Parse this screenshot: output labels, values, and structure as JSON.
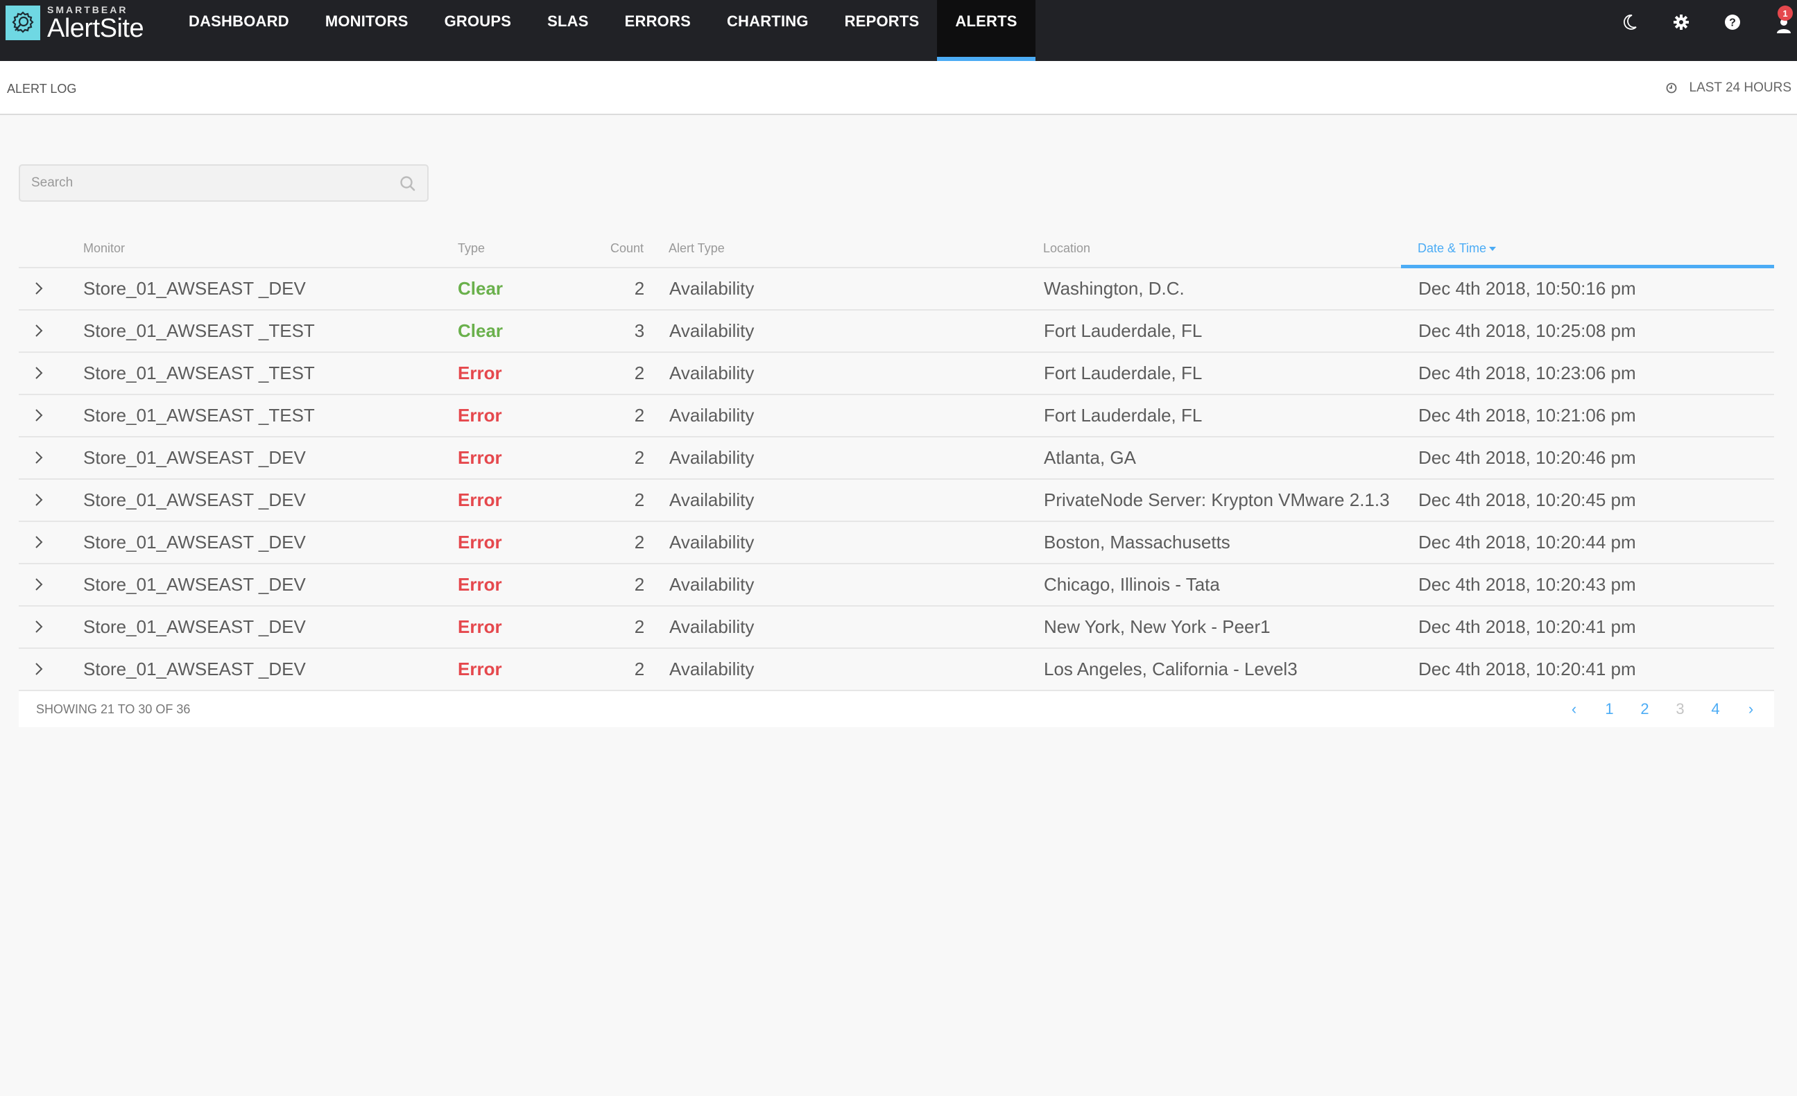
{
  "app": {
    "brand": "SMARTBEAR",
    "product": "AlertSite"
  },
  "nav": {
    "items": [
      {
        "label": "DASHBOARD",
        "active": false
      },
      {
        "label": "MONITORS",
        "active": false
      },
      {
        "label": "GROUPS",
        "active": false
      },
      {
        "label": "SLAS",
        "active": false
      },
      {
        "label": "ERRORS",
        "active": false
      },
      {
        "label": "CHARTING",
        "active": false
      },
      {
        "label": "REPORTS",
        "active": false
      },
      {
        "label": "ALERTS",
        "active": true
      }
    ],
    "icons": [
      "moon-icon",
      "gear-icon",
      "help-icon",
      "user-icon"
    ],
    "notification_count": "1"
  },
  "subheader": {
    "title": "ALERT LOG",
    "time_range": "LAST 24 HOURS"
  },
  "search": {
    "placeholder": "Search",
    "value": ""
  },
  "table": {
    "columns": {
      "monitor": "Monitor",
      "type": "Type",
      "count": "Count",
      "alert_type": "Alert Type",
      "location": "Location",
      "date_time": "Date & Time"
    },
    "sorted_by": "date_time",
    "sort_direction": "desc",
    "rows": [
      {
        "monitor": "Store_01_AWSEAST _DEV",
        "type": "Clear",
        "count": "2",
        "alert_type": "Availability",
        "location": "Washington, D.C.",
        "date_time": "Dec 4th 2018, 10:50:16 pm"
      },
      {
        "monitor": "Store_01_AWSEAST _TEST",
        "type": "Clear",
        "count": "3",
        "alert_type": "Availability",
        "location": "Fort Lauderdale, FL",
        "date_time": "Dec 4th 2018, 10:25:08 pm"
      },
      {
        "monitor": "Store_01_AWSEAST _TEST",
        "type": "Error",
        "count": "2",
        "alert_type": "Availability",
        "location": "Fort Lauderdale, FL",
        "date_time": "Dec 4th 2018, 10:23:06 pm"
      },
      {
        "monitor": "Store_01_AWSEAST _TEST",
        "type": "Error",
        "count": "2",
        "alert_type": "Availability",
        "location": "Fort Lauderdale, FL",
        "date_time": "Dec 4th 2018, 10:21:06 pm"
      },
      {
        "monitor": "Store_01_AWSEAST _DEV",
        "type": "Error",
        "count": "2",
        "alert_type": "Availability",
        "location": "Atlanta, GA",
        "date_time": "Dec 4th 2018, 10:20:46 pm"
      },
      {
        "monitor": "Store_01_AWSEAST _DEV",
        "type": "Error",
        "count": "2",
        "alert_type": "Availability",
        "location": "PrivateNode Server: Krypton VMware 2.1.3",
        "date_time": "Dec 4th 2018, 10:20:45 pm"
      },
      {
        "monitor": "Store_01_AWSEAST _DEV",
        "type": "Error",
        "count": "2",
        "alert_type": "Availability",
        "location": "Boston, Massachusetts",
        "date_time": "Dec 4th 2018, 10:20:44 pm"
      },
      {
        "monitor": "Store_01_AWSEAST _DEV",
        "type": "Error",
        "count": "2",
        "alert_type": "Availability",
        "location": "Chicago, Illinois - Tata",
        "date_time": "Dec 4th 2018, 10:20:43 pm"
      },
      {
        "monitor": "Store_01_AWSEAST _DEV",
        "type": "Error",
        "count": "2",
        "alert_type": "Availability",
        "location": "New York, New York - Peer1",
        "date_time": "Dec 4th 2018, 10:20:41 pm"
      },
      {
        "monitor": "Store_01_AWSEAST _DEV",
        "type": "Error",
        "count": "2",
        "alert_type": "Availability",
        "location": "Los Angeles, California - Level3",
        "date_time": "Dec 4th 2018, 10:20:41 pm"
      }
    ]
  },
  "footer": {
    "showing": "SHOWING 21 TO 30 OF 36"
  },
  "pagination": {
    "prev": "‹",
    "next": "›",
    "pages": [
      "1",
      "2",
      "3",
      "4"
    ],
    "current": "3"
  },
  "colors": {
    "nav_bg": "#212226",
    "nav_active_bg": "#0e0e0f",
    "accent": "#4cacf5",
    "clear": "#6ab04c",
    "error": "#e5484d",
    "logo": "#6fd8e3"
  }
}
